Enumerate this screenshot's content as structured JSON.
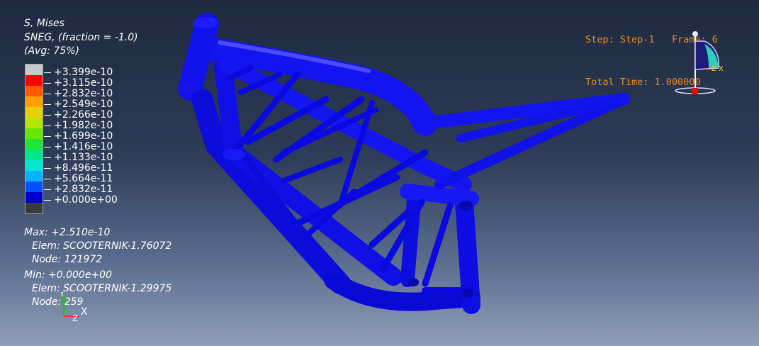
{
  "legend": {
    "title_lines": [
      "S, Mises",
      "SNEG, (fraction = -1.0)",
      "(Avg: 75%)"
    ],
    "colors": [
      "#c8c8c8",
      "#ff0000",
      "#ff5a00",
      "#ffa000",
      "#e8d000",
      "#b4e600",
      "#64e600",
      "#1ee632",
      "#00e68c",
      "#00e6d0",
      "#00b4ff",
      "#0050ff",
      "#0000c8",
      "#3a3a3a"
    ],
    "values": [
      "+3.399e-10",
      "+3.115e-10",
      "+2.832e-10",
      "+2.549e-10",
      "+2.266e-10",
      "+1.982e-10",
      "+1.699e-10",
      "+1.416e-10",
      "+1.133e-10",
      "+8.496e-11",
      "+5.664e-11",
      "+2.832e-11",
      "+0.000e+00"
    ]
  },
  "max": {
    "label": "Max: +2.510e-10",
    "elem": "Elem: SCOOTERNIK-1.76072",
    "node": "Node: 121972"
  },
  "min": {
    "label": "Min: +0.000e+00",
    "elem": "Elem: SCOOTERNIK-1.29975",
    "node": "Node: 259"
  },
  "step": {
    "line1": "Step: Step-1   Frame: 6",
    "line2": "Total Time: 1.000000"
  },
  "axes": {
    "x": "X",
    "y": "Y",
    "z": "Z"
  },
  "colors": {
    "frame_main": "#1010f0",
    "frame_dark": "#0000b0",
    "accent_orange": "#f08a24"
  }
}
